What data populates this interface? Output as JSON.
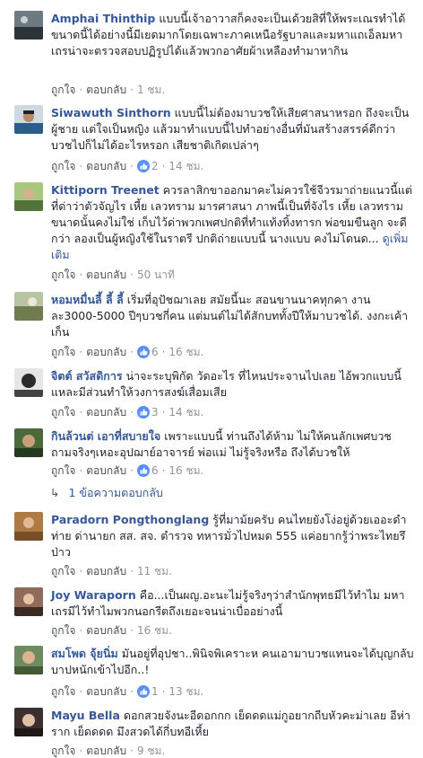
{
  "labels": {
    "like": "ถูกใจ",
    "reply": "ตอบกลับ"
  },
  "comments": [
    {
      "author": "Amphai Thinthip",
      "text": "แบบนี้เจ้าอาวาสก็คงจะเป็นเด้วยสิที่ให้พระเณรทำได้ขนาดนี้ได้อย่างนี้มีเยดมากโดยเฉพาะภาคเหนือรัฐบาลและมหาแถเอ็ลมหาเถรน่าจะตรวจสอบปฏิรูปได้แล้วพวกอาศัยผ้าเหลืองทำมาหากิน",
      "more": "",
      "reactions": "",
      "time": "1 ชม."
    },
    {
      "author": "Siwawuth Sinthorn",
      "text": "แบบนี้ไม่ต้องมาบวชให้เสียศาสนาหรอก ถึงจะเป็นผู้ชาย แต่ใจเป็นหญิง แล้วมาทำแบบนี้ไปทำอย่างอื่นที่มันสร้างสรรค์ดีกว่า บวชไปก็ไม่ได้อะไรหรอก เสียชาติเกิดเปล่าๆ",
      "more": "",
      "reactions": "2",
      "time": "14 ชม."
    },
    {
      "author": "Kittiporn Treenet",
      "text": "ควรลาสิกขาออกมาคะไม่ควรใช้จีวรมาถ่ายแนวนี้แต่ที่ด่าว่าตัวจัญไร เหี้ย เลวทราม มารศาสนา ภาพนี้เป็นที่จังไร เหี้ย เลวทรามขนาดนั้นคงไม่ใช่ เก็บไว้ด่าพวกเพศปกติที่ทำแท้งทิ้งทารก พ่อขมขืนลูก จะดีกว่า ลองเป็นผู้หญิงใช้ในราตรี ปกติถ่ายแบบนี้ นางแบบ คงไม่โดนด...",
      "more": "ดูเพิ่มเติม",
      "reactions": "",
      "time": "50 นาที"
    },
    {
      "author": "หอมหมื่นลี้ ลี้ ลี้",
      "text": "เริ่มที่อุปัชฌาเลย สมัยนี้นะ สอนขานนาคทุกคา งานละ3000-5000 ปีๆบวชกี่คน แต่มนต์ไม่ได้สักบททั้งปีให้มาบวชได้. งงกะเค้าเก็น",
      "more": "",
      "reactions": "6",
      "time": "16 ชม."
    },
    {
      "author": "จิตต์ สวัสดิการ",
      "text": "น่าจะระบุพิกัด วัดอะไร ที่ไหนประจานไปเลย ไอ้พวกแบบนี้แหละมีส่วนทำให้วงการสงฆ์เสื่อมเสีย",
      "more": "",
      "reactions": "3",
      "time": "14 ชม."
    },
    {
      "author": "กินล้วนต่ เอาที่สบายใจ",
      "text": "เพราะแบบนี้ ท่านถึงได้ห้าม ไม่ให้คนลักเพศบวช ถามจริงๆเหอะอุปฌาย์อาจารย์ พ่อแม่ ไม่รู้จริงหรือ ถึงได้บวชให้",
      "more": "",
      "reactions": "6",
      "time": "16 ชม."
    },
    {
      "author": "Paradorn Pongthonglang",
      "text": "รู้ที่มาม้ยครับ คนไทยยังโง่อยู่ด้วยเออะดำท่าย ด่านายก สส. สจ. ตำรวจ ทหารมั่วไปหมด 555 แค่อยากรู้ว่าพระไทยรึป่าว",
      "more": "",
      "reactions": "",
      "time": "11 ชม."
    },
    {
      "author": "Joy Waraporn",
      "text": "คือ...เป็นผญ.อะนะไม่รู้จริงๆว่าสำนักพุทธมีไว้ทำไม มหาเถรมีไว้ทำไมพวกนอกรีตถึงเยอะจนน่าเบื่ออย่างนี้",
      "more": "",
      "reactions": "",
      "time": "16 ชม."
    },
    {
      "author": "สมโพด จุ้ยนิ่ม",
      "text": "มันอยู่ที่อุปชา..พินิจพิเคราะห คนเอามาบวชแทนจะได้บุญกลับบาปหนักเข้าไปอีก..!",
      "more": "",
      "reactions": "1",
      "time": "13 ชม."
    },
    {
      "author": "Mayu Bella",
      "text": "ดอกสวยจังนะอีดอกกก เย็ดดดแม่กูอยากถีบหัวคะม่าเลย อีห่าราก เย็ดดดด มึงสวดได้กี่บทอีเหี้ย",
      "more": "",
      "reactions": "",
      "time": "9 ชม."
    }
  ],
  "reply_link": "1 ข้อความตอบกลับ",
  "colors": {
    "link": "#365899",
    "meta": "#90949c",
    "like_blue": "#5890ff"
  }
}
